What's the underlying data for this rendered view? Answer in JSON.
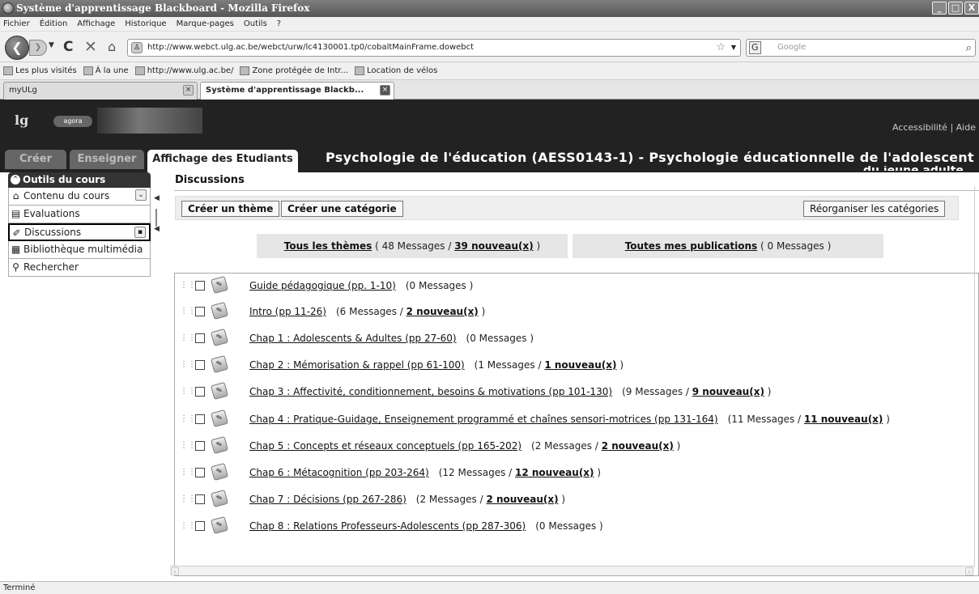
{
  "window": {
    "title": "Système d'apprentissage Blackboard - Mozilla Firefox",
    "min": "_",
    "max": "□",
    "close": "X"
  },
  "menu": [
    "Fichier",
    "Édition",
    "Affichage",
    "Historique",
    "Marque-pages",
    "Outils",
    "?"
  ],
  "nav": {
    "url": "http://www.webct.ulg.ac.be/webct/urw/lc4130001.tp0/cobaltMainFrame.dowebct",
    "search_placeholder": "Google",
    "search_engine": "G"
  },
  "bookmarks": [
    "Les plus visités",
    "À la une",
    "http://www.ulg.ac.be/",
    "Zone protégée de Intr...",
    "Location de vélos"
  ],
  "tabs": [
    {
      "label": "myULg"
    },
    {
      "label": "Système d'apprentissage Blackb..."
    }
  ],
  "header": {
    "logo_text": "lg",
    "logo_agora": "agora",
    "accessibility": "Accessibilité",
    "separator": "|",
    "help": "Aide",
    "roles": [
      "Créer",
      "Enseigner",
      "Affichage des Etudiants"
    ],
    "course_title": "Psychologie de l'éducation (AESS0143-1) - Psychologie éducationnelle de l'adolescent et",
    "course_title_cont": "du jeune adulte"
  },
  "sidebar": {
    "heading": "Outils du cours",
    "items": [
      {
        "label": "Contenu du cours",
        "icon": "home-icon"
      },
      {
        "label": "Evaluations",
        "icon": "clipboard-icon"
      },
      {
        "label": "Discussions",
        "icon": "pin-icon"
      },
      {
        "label": "Bibliothèque multimédia",
        "icon": "library-icon"
      },
      {
        "label": "Rechercher",
        "icon": "search-icon"
      }
    ]
  },
  "main": {
    "title": "Discussions",
    "buttons": {
      "create_theme": "Créer un thème",
      "create_category": "Créer une catégorie",
      "reorganize": "Réorganiser les catégories"
    },
    "filters": {
      "all_label": "Tous les thèmes",
      "all_pre": "( 48 Messages / ",
      "all_new": "39 nouveau(x)",
      "all_post": " )",
      "mine_label": "Toutes mes publications",
      "mine_count": "( 0 Messages )"
    },
    "topics": [
      {
        "title": "Guide pédagogique (pp. 1-10)",
        "count": "(0 Messages )",
        "new": "",
        "tail": ""
      },
      {
        "title": "Intro (pp 11-26)",
        "count": "(6 Messages / ",
        "new": "2 nouveau(x)",
        "tail": " )"
      },
      {
        "title": "Chap 1 : Adolescents & Adultes (pp 27-60)",
        "count": "(0 Messages )",
        "new": "",
        "tail": ""
      },
      {
        "title": "Chap 2 : Mémorisation & rappel (pp 61-100)",
        "count": "(1 Messages / ",
        "new": "1 nouveau(x)",
        "tail": " )"
      },
      {
        "title": "Chap 3 : Affectivité, conditionnement, besoins & motivations (pp 101-130)",
        "count": "(9 Messages / ",
        "new": "9 nouveau(x)",
        "tail": " )"
      },
      {
        "title": "Chap 4 : Pratique-Guidage, Enseignement programmé et chaînes sensori-motrices (pp 131-164)",
        "count": "(11 Messages / ",
        "new": "11 nouveau(x)",
        "tail": " )"
      },
      {
        "title": "Chap 5 : Concepts et réseaux conceptuels (pp 165-202)",
        "count": "(2 Messages / ",
        "new": "2 nouveau(x)",
        "tail": " )"
      },
      {
        "title": "Chap 6 : Métacognition (pp 203-264)",
        "count": "(12 Messages / ",
        "new": "12 nouveau(x)",
        "tail": " )"
      },
      {
        "title": "Chap 7 : Décisions (pp 267-286)",
        "count": "(2 Messages / ",
        "new": "2 nouveau(x)",
        "tail": " )"
      },
      {
        "title": "Chap 8 : Relations Professeurs-Adolescents (pp 287-306)",
        "count": "(0 Messages )",
        "new": "",
        "tail": ""
      }
    ]
  },
  "status": "Terminé"
}
